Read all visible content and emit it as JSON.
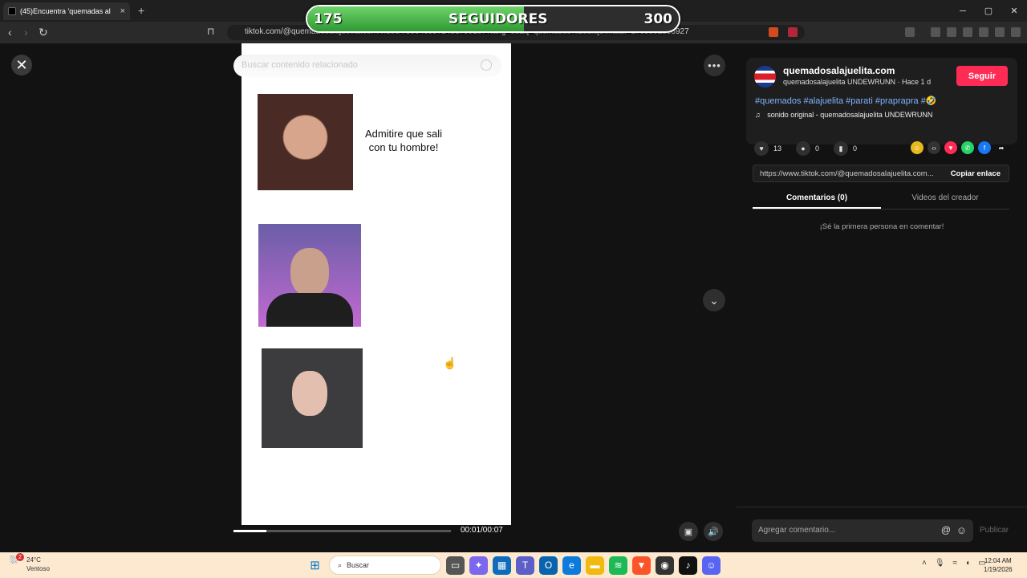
{
  "browser": {
    "tab_title": "(45)Encuentra 'quemadas al",
    "tab_close": "×",
    "new_tab": "+",
    "url": "tiktok.com/@quemadosalajuelita.com/video/7596469572483790167?lang=es&q=quemados%20alajuelita&t=1768802598927",
    "win_min": "─",
    "win_max": "▢",
    "win_close": "✕"
  },
  "overlay": {
    "current": "175",
    "label": "SEGUIDORES",
    "goal": "300",
    "progress_fraction": 0.583
  },
  "video": {
    "search_placeholder": "Buscar contenido relacionado",
    "caption": "Admitire que sali con tu hombre!",
    "time": "00:01/00:07",
    "progress_fraction": 0.15
  },
  "post": {
    "username": "quemadosalajuelita.com",
    "subtitle": "quemadosalajuelita UNDEWRUNN · Hace 1 d",
    "follow_label": "Seguir",
    "hashtags": "#quemados #alajuelita #parati #prapraprа #🤣",
    "sound": "sonido original - quemadosalajuelita UNDEWRUNN",
    "likes": "13",
    "comments": "0",
    "saves": "0",
    "link": "https://www.tiktok.com/@quemadosalajuelita.com...",
    "copy_label": "Copiar enlace",
    "tab_comments": "Comentarios (0)",
    "tab_videos": "Videos del creador",
    "empty_text": "¡Sé la primera persona en comentar!",
    "comment_placeholder": "Agregar comentario...",
    "publish_label": "Publicar"
  },
  "taskbar": {
    "temp": "24°C",
    "condition": "Ventoso",
    "weather_badge": "2",
    "search_label": "Buscar",
    "time": "12:04 AM",
    "date": "1/19/2026"
  },
  "colors": {
    "accent": "#fe2c55",
    "hashtag": "#7fb2ff",
    "counter_fill": "#2e9a33"
  }
}
